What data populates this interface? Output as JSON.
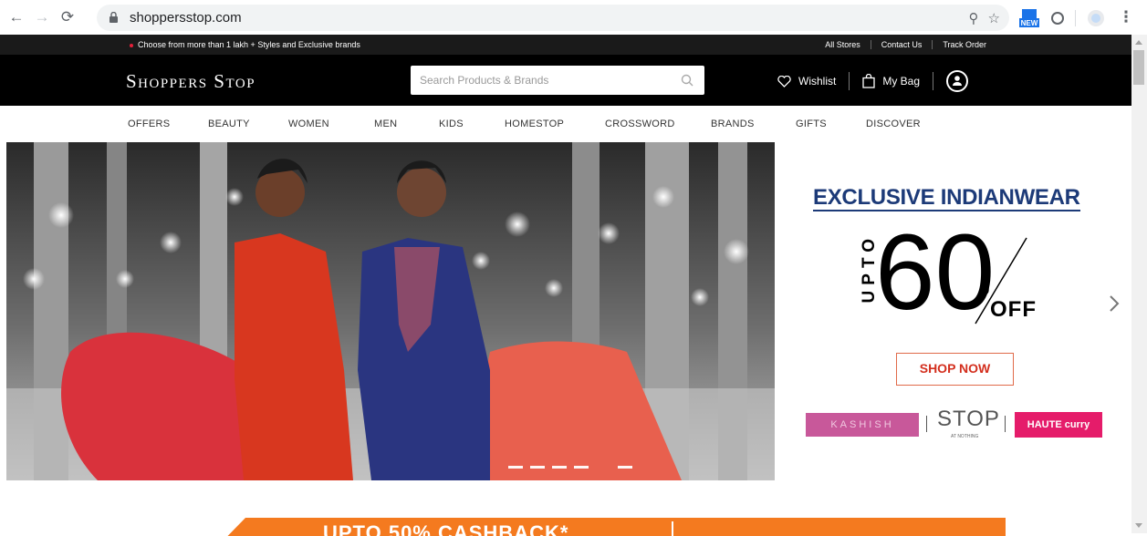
{
  "browser": {
    "url": "shoppersstop.com",
    "badge": "NEW"
  },
  "topstrip": {
    "promo": "Choose from more than 1 lakh + Styles and Exclusive brands",
    "links": [
      "All Stores",
      "Contact Us",
      "Track Order"
    ]
  },
  "header": {
    "logo": "Shoppers Stop",
    "search_placeholder": "Search Products & Brands",
    "wishlist": "Wishlist",
    "bag": "My Bag"
  },
  "nav": {
    "items": [
      "OFFERS",
      "BEAUTY",
      "WOMEN",
      "MEN",
      "KIDS",
      "HOMESTOP",
      "CROSSWORD",
      "BRANDS",
      "GIFTS",
      "DISCOVER"
    ]
  },
  "hero": {
    "headline": "EXCLUSIVE INDIANWEAR",
    "upto": "UPTO",
    "discount": "60",
    "percent_zero": "0",
    "off": "OFF",
    "cta": "SHOP NOW",
    "brands": {
      "kashish": "KASHISH",
      "stop": "STOP",
      "stop_sub": "AT NOTHING",
      "haute": "HAUTE curry"
    },
    "slides_total": 6,
    "slides_visible_dashes": 4
  },
  "banner": {
    "text": "UPTO 50% CASHBACK*"
  },
  "colors": {
    "accent_navy": "#1c3a78",
    "cta_red": "#d32f1e",
    "banner_orange": "#f47a1f",
    "kashish_pink": "#c8589a",
    "haute_pink": "#e51c6a"
  }
}
